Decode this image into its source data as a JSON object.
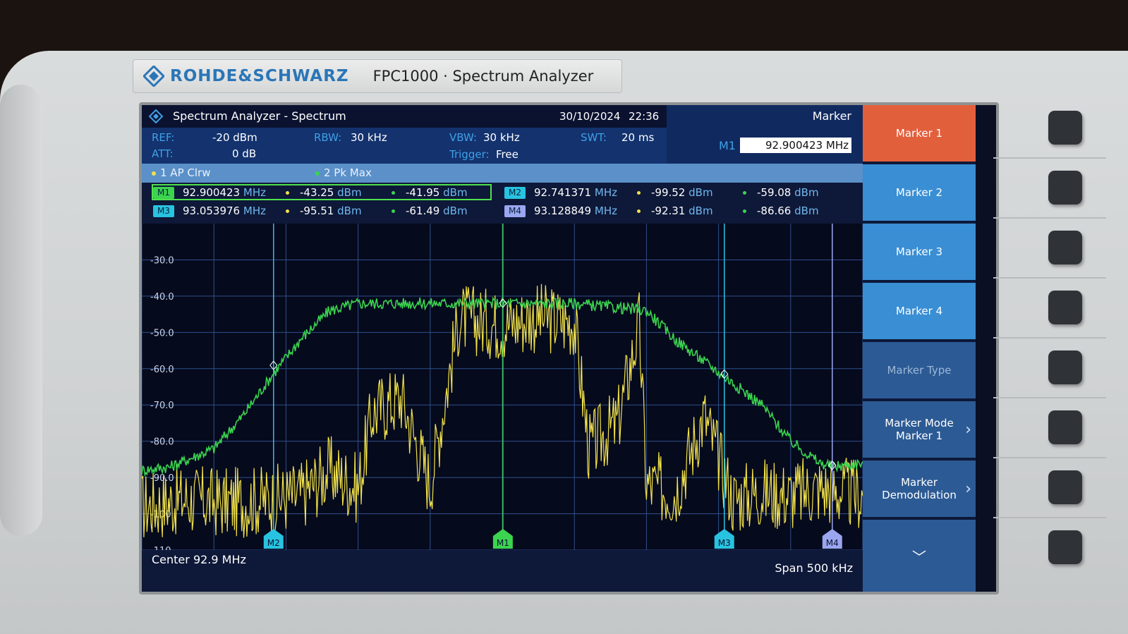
{
  "device": {
    "brand": "ROHDE&SCHWARZ",
    "model": "FPC1000 · Spectrum Analyzer"
  },
  "title_bar": {
    "app_title": "Spectrum Analyzer - Spectrum",
    "date": "30/10/2024",
    "time": "22:36"
  },
  "settings": {
    "ref_label": "REF:",
    "ref_value": "-20 dBm",
    "att_label": "ATT:",
    "att_value": "0 dB",
    "rbw_label": "RBW:",
    "rbw_value": "30 kHz",
    "vbw_label": "VBW:",
    "vbw_value": "30 kHz",
    "trigger_label": "Trigger:",
    "trigger_value": "Free",
    "swt_label": "SWT:",
    "swt_value": "20 ms"
  },
  "traces": [
    {
      "label": "1 AP  Clrw",
      "color": "#f2e24a"
    },
    {
      "label": "2 Pk  Max",
      "color": "#3bd34f"
    }
  ],
  "markers": [
    {
      "tag": "M1",
      "freq": "92.900423",
      "unit": "MHz",
      "trace1": "-43.25",
      "trace2": "-41.95",
      "level_unit": "dBm",
      "color": "#3bd34f"
    },
    {
      "tag": "M2",
      "freq": "92.741371",
      "unit": "MHz",
      "trace1": "-99.52",
      "trace2": "-59.08",
      "level_unit": "dBm",
      "color": "#28c3e0"
    },
    {
      "tag": "M3",
      "freq": "93.053976",
      "unit": "MHz",
      "trace1": "-95.51",
      "trace2": "-61.49",
      "level_unit": "dBm",
      "color": "#28c3e0"
    },
    {
      "tag": "M4",
      "freq": "93.128849",
      "unit": "MHz",
      "trace1": "-92.31",
      "trace2": "-86.66",
      "level_unit": "dBm",
      "color": "#9aa6ef"
    }
  ],
  "sidebar": {
    "title": "Marker",
    "edit_label": "M1",
    "edit_value": "92.900423 MHz"
  },
  "softkeys": [
    {
      "label": "Marker 1",
      "state": "active"
    },
    {
      "label": "Marker 2",
      "state": "normal"
    },
    {
      "label": "Marker 3",
      "state": "normal"
    },
    {
      "label": "Marker 4",
      "state": "normal"
    },
    {
      "label": "Marker Type",
      "state": "disabled"
    },
    {
      "label": "Marker Mode",
      "label2": "Marker 1",
      "state": "submenu"
    },
    {
      "label": "Marker",
      "label2": "Demodulation",
      "state": "submenu"
    },
    {
      "label": "﹀",
      "state": "more"
    }
  ],
  "bottom": {
    "center": "Center 92.9 MHz",
    "span": "Span 500 kHz"
  },
  "chart_data": {
    "type": "line",
    "xlim": [
      92.65,
      93.15
    ],
    "ylim": [
      -110,
      -20
    ],
    "y_ticks": [
      "-30.0",
      "-40.0",
      "-50.0",
      "-60.0",
      "-70.0",
      "-80.0",
      "-90.0",
      "-100",
      "-110"
    ],
    "series": [
      {
        "name": "1 AP Clrw",
        "color": "#f2e24a",
        "x": [
          92.65,
          92.68,
          92.71,
          92.74,
          92.76,
          92.78,
          92.8,
          92.81,
          92.83,
          92.85,
          92.87,
          92.9,
          92.92,
          92.95,
          92.96,
          92.98,
          92.995,
          93.0,
          93.02,
          93.04,
          93.06,
          93.08,
          93.1,
          93.12,
          93.15
        ],
        "y": [
          -98,
          -96,
          -97,
          -96,
          -95,
          -88,
          -93,
          -72,
          -68,
          -92,
          -46,
          -48,
          -46,
          -47,
          -82,
          -75,
          -48,
          -92,
          -94,
          -73,
          -96,
          -94,
          -95,
          -93,
          -95
        ]
      },
      {
        "name": "2 Pk Max",
        "color": "#3bd34f",
        "x": [
          92.65,
          92.67,
          92.7,
          92.72,
          92.74,
          92.76,
          92.78,
          92.8,
          92.85,
          92.9,
          92.95,
          93.0,
          93.02,
          93.05,
          93.08,
          93.1,
          93.12,
          93.13,
          93.15
        ],
        "y": [
          -88,
          -87,
          -82,
          -73,
          -62,
          -52,
          -44,
          -42,
          -42,
          -42,
          -42,
          -44,
          -52,
          -61,
          -70,
          -80,
          -86,
          -87,
          -86
        ]
      }
    ],
    "markers": [
      {
        "tag": "M1",
        "x": 92.900423,
        "y": -41.95
      },
      {
        "tag": "M2",
        "x": 92.741371,
        "y": -59.08
      },
      {
        "tag": "M3",
        "x": 93.053976,
        "y": -61.49
      },
      {
        "tag": "M4",
        "x": 93.128849,
        "y": -86.66
      }
    ],
    "grid": true
  }
}
